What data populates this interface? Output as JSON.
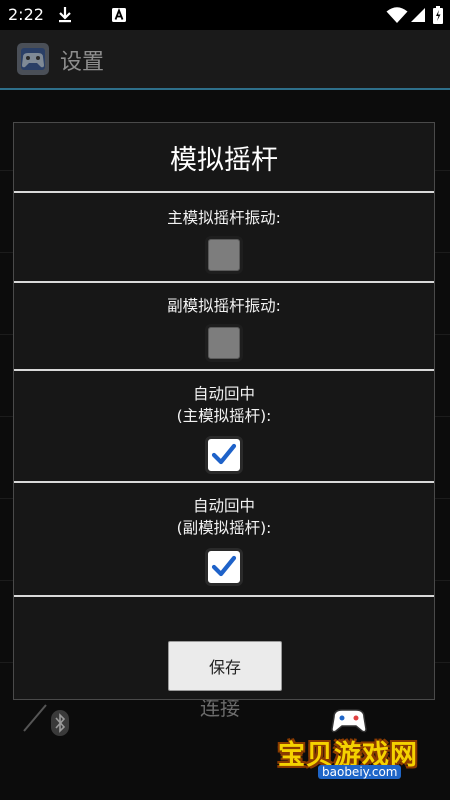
{
  "status_bar": {
    "time": "2:22",
    "icons": [
      "download-icon",
      "font-a-icon",
      "wifi-icon",
      "signal-icon",
      "battery-icon"
    ]
  },
  "action_bar": {
    "title": "设置",
    "icon": "gamepad-app-icon"
  },
  "background": {
    "bottom_label": "连接",
    "icon": "bluetooth-icon"
  },
  "dialog": {
    "title": "模拟摇杆",
    "options": [
      {
        "label": "主模拟摇杆振动:",
        "checked": false
      },
      {
        "label": "副模拟摇杆振动:",
        "checked": false
      },
      {
        "label": "自动回中\n(主模拟摇杆):",
        "checked": true
      },
      {
        "label": "自动回中\n(副模拟摇杆):",
        "checked": true
      }
    ],
    "save_label": "保存"
  },
  "watermark": {
    "text": "宝贝游戏网",
    "url": "baobeiy.com"
  },
  "colors": {
    "accent_line": "#2e6f8a",
    "check_blue": "#1e62c9",
    "watermark_yellow": "#f5d200"
  }
}
